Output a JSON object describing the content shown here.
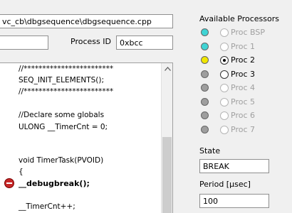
{
  "file_path": "vc_cb\\dbgsequence\\dbgsequence.cpp",
  "process": {
    "label": "Process ID",
    "value": "0xbcc"
  },
  "code_lines": [
    "//************************",
    "SEQ_INIT_ELEMENTS();",
    "//************************",
    "//Declare some globals",
    "ULONG __TimerCnt = 0;",
    "void TimerTask(PVOID)",
    "{",
    "__debugbreak();",
    "__TimerCnt++;"
  ],
  "processors": {
    "title": "Available Processors",
    "items": [
      {
        "label": "Proc BSP",
        "led": "#3fd4d4",
        "enabled": false,
        "selected": false
      },
      {
        "label": "Proc 1",
        "led": "#3fd4d4",
        "enabled": false,
        "selected": false
      },
      {
        "label": "Proc 2",
        "led": "#f0e600",
        "enabled": true,
        "selected": true
      },
      {
        "label": "Proc 3",
        "led": "#9e9e9e",
        "enabled": true,
        "selected": false
      },
      {
        "label": "Proc 4",
        "led": "#9e9e9e",
        "enabled": false,
        "selected": false
      },
      {
        "label": "Proc 5",
        "led": "#9e9e9e",
        "enabled": false,
        "selected": false
      },
      {
        "label": "Proc 6",
        "led": "#9e9e9e",
        "enabled": false,
        "selected": false
      },
      {
        "label": "Proc 7",
        "led": "#9e9e9e",
        "enabled": false,
        "selected": false
      }
    ]
  },
  "state": {
    "label": "State",
    "value": "BREAK"
  },
  "period": {
    "label": "Period [µsec]",
    "value": "100"
  },
  "colors": {
    "breakpoint": "#c62828",
    "led_cyan": "#3fd4d4",
    "led_yellow": "#f0e600",
    "led_gray": "#9e9e9e"
  }
}
